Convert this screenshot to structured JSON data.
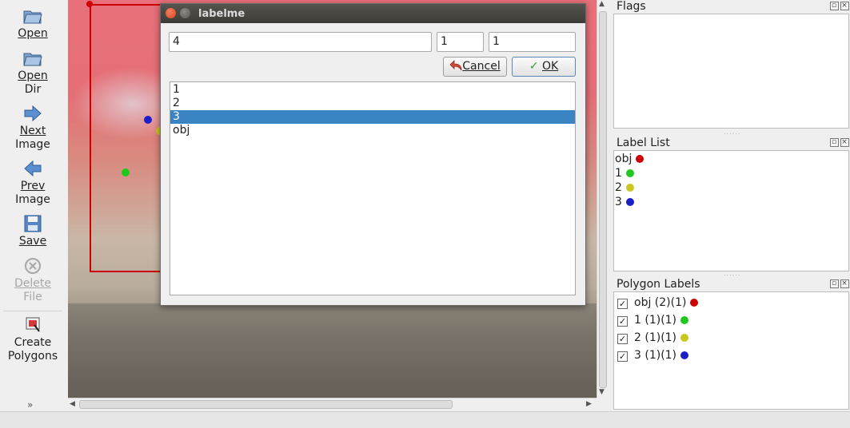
{
  "toolbar": {
    "open": "Open",
    "open_dir_1": "Open",
    "open_dir_2": "Dir",
    "next_1": "Next",
    "next_2": "Image",
    "prev_1": "Prev",
    "prev_2": "Image",
    "save": "Save",
    "delete_1": "Delete",
    "delete_2": "File",
    "create_1": "Create",
    "create_2": "Polygons"
  },
  "docks": {
    "flags_title": "Flags",
    "label_list_title": "Label List",
    "polygon_labels_title": "Polygon Labels"
  },
  "label_list": [
    {
      "text": "obj",
      "color": "#cc0000"
    },
    {
      "text": "1",
      "color": "#1ec81e"
    },
    {
      "text": "2",
      "color": "#c8c81e"
    },
    {
      "text": "3",
      "color": "#1e1ec8"
    }
  ],
  "polygon_labels": [
    {
      "text": "obj (2)(1)",
      "color": "#cc0000",
      "checked": "✓"
    },
    {
      "text": "1 (1)(1)",
      "color": "#1ec81e",
      "checked": "✓"
    },
    {
      "text": "2 (1)(1)",
      "color": "#c8c81e",
      "checked": "✓"
    },
    {
      "text": "3 (1)(1)",
      "color": "#1e1ec8",
      "checked": "✓"
    }
  ],
  "dialog": {
    "title": "labelme",
    "label_value": "4",
    "field2_value": "1",
    "field3_value": "1",
    "cancel": "Cancel",
    "ok": "OK",
    "items": [
      "1",
      "2",
      "3",
      "obj"
    ],
    "selected_item": "3"
  },
  "colors": {
    "accent": "#3a84c4",
    "bbox": "#cc0000"
  }
}
